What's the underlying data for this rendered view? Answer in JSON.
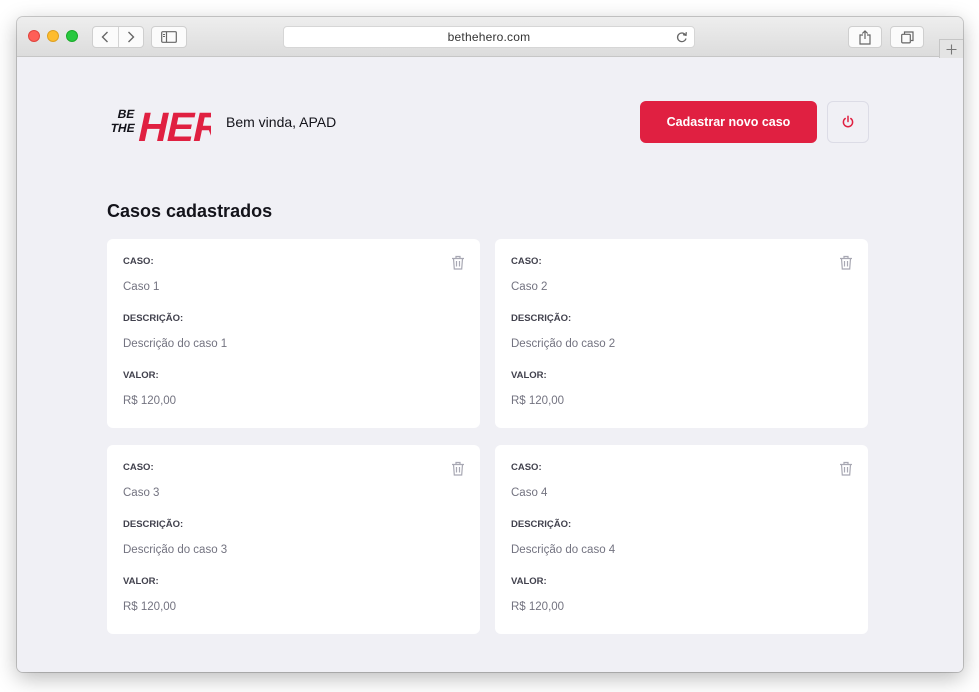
{
  "browser": {
    "url": "bethehero.com"
  },
  "header": {
    "logo_text": "BE THE HERO",
    "welcome": "Bem vinda, APAD",
    "new_case_button": "Cadastrar novo caso"
  },
  "main": {
    "title": "Casos cadastrados",
    "labels": {
      "case": "CASO:",
      "description": "DESCRIÇÃO:",
      "value": "VALOR:"
    },
    "cases": [
      {
        "case": "Caso 1",
        "description": "Descrição do caso 1",
        "value": "R$ 120,00"
      },
      {
        "case": "Caso 2",
        "description": "Descrição do caso 2",
        "value": "R$ 120,00"
      },
      {
        "case": "Caso 3",
        "description": "Descrição do caso 3",
        "value": "R$ 120,00"
      },
      {
        "case": "Caso 4",
        "description": "Descrição do caso 4",
        "value": "R$ 120,00"
      }
    ]
  },
  "colors": {
    "brand": "#e02041",
    "background": "#f0f0f5",
    "label": "#41414d",
    "value": "#737380"
  },
  "icons": {
    "back": "chevron-left-icon",
    "forward": "chevron-right-icon",
    "sidebar": "sidebar-icon",
    "reload": "reload-icon",
    "share": "share-icon",
    "tabs": "tabs-icon",
    "new_tab": "plus-icon",
    "logout": "power-icon",
    "delete": "trash-icon"
  }
}
